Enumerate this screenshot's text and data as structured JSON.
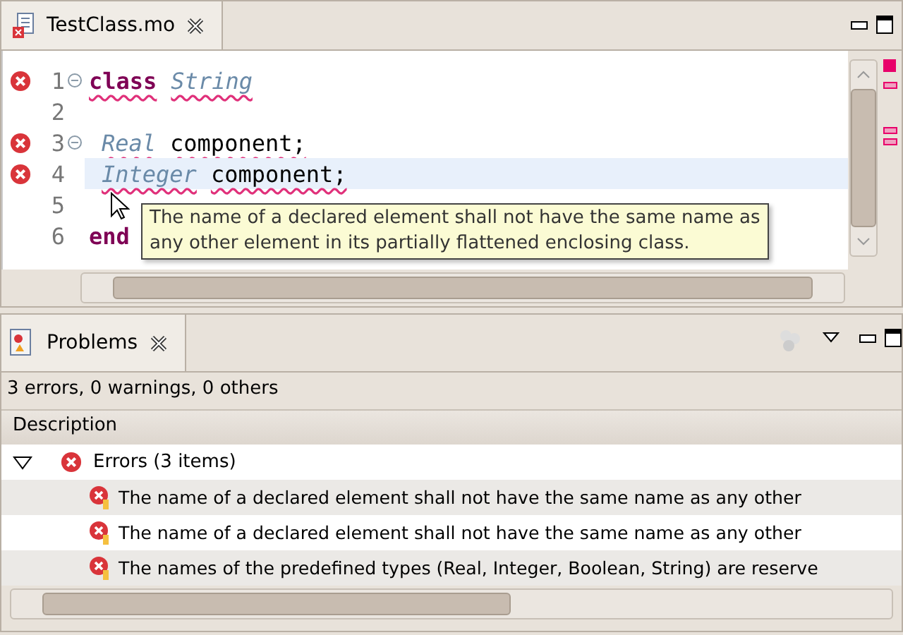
{
  "editor": {
    "tab": {
      "title": "TestClass.mo",
      "selected": true
    },
    "lines": [
      {
        "number": "1",
        "error": true,
        "fold": true,
        "current": false,
        "tokens": [
          {
            "kind": "keyword",
            "text": "class"
          },
          {
            "kind": "type",
            "text": "String"
          }
        ]
      },
      {
        "number": "2",
        "error": false,
        "fold": false,
        "current": false
      },
      {
        "number": "3",
        "error": true,
        "fold": true,
        "current": false,
        "tokens": [
          {
            "kind": "type",
            "text": "Real"
          },
          {
            "kind": "ident",
            "text": "component;"
          }
        ]
      },
      {
        "number": "4",
        "error": true,
        "fold": false,
        "current": true,
        "tokens": [
          {
            "kind": "type",
            "text": "Integer"
          },
          {
            "kind": "ident",
            "text": "component;"
          }
        ]
      },
      {
        "number": "5",
        "error": false,
        "fold": false,
        "current": false
      },
      {
        "number": "6",
        "error": false,
        "fold": false,
        "current": false,
        "tokens": [
          {
            "kind": "keyword",
            "text": "end"
          }
        ]
      }
    ],
    "tooltip": [
      "The name of a declared element shall not have the same name as",
      "any other element in its partially flattened enclosing class."
    ]
  },
  "problems": {
    "tab": {
      "title": "Problems",
      "selected": true
    },
    "summary": "3 errors, 0 warnings, 0 others",
    "columns": [
      "Description"
    ],
    "groups": [
      {
        "label": "Errors (3 items)",
        "expanded": true,
        "children": [
          {
            "text": "The name of a declared element shall not have the same name as any other"
          },
          {
            "text": "The name of a declared element shall not have the same name as any other"
          },
          {
            "text": "The names of the predefined types (Real, Integer, Boolean, String) are reserve"
          }
        ]
      }
    ]
  }
}
